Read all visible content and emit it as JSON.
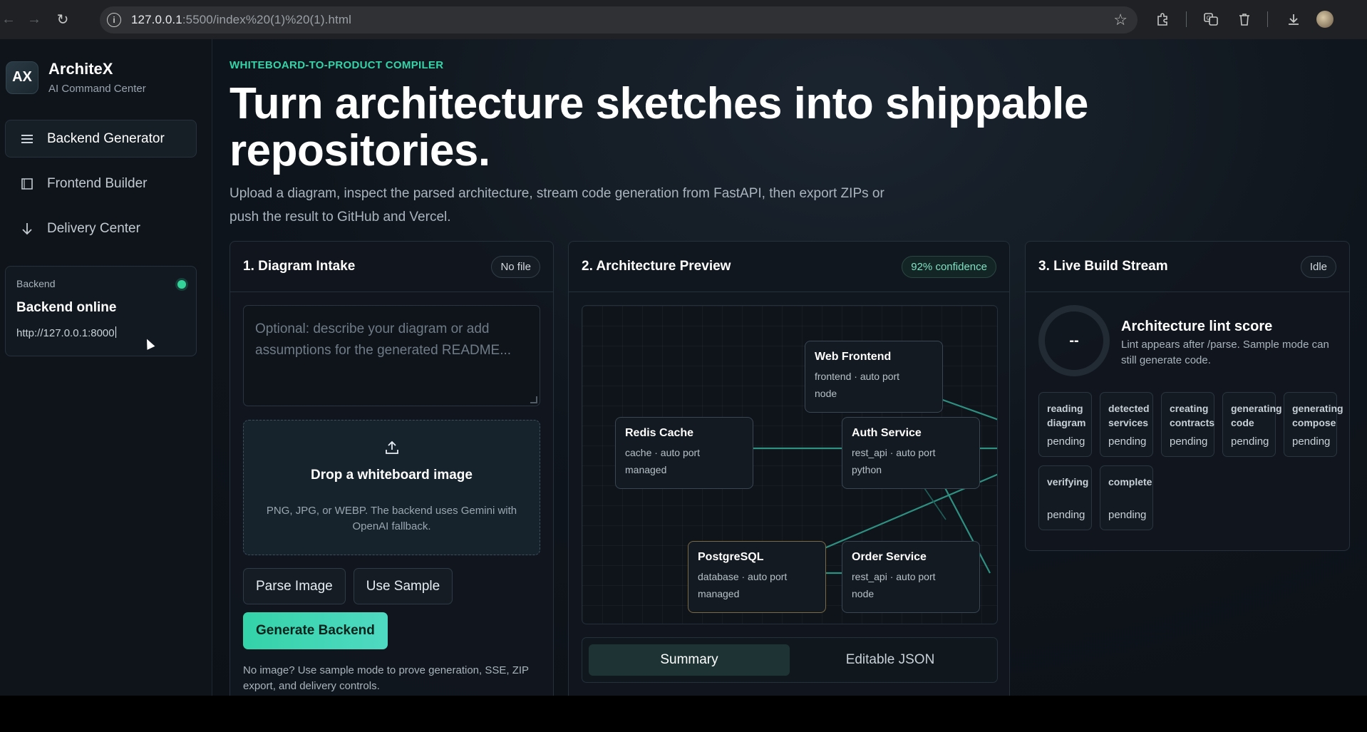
{
  "browser": {
    "url_host": "127.0.0.1",
    "url_path": ":5500/index%20(1)%20(1).html"
  },
  "brand": {
    "logo": "AX",
    "name": "ArchiteX",
    "subtitle": "AI Command Center"
  },
  "sidebar": {
    "items": [
      {
        "label": "Backend Generator",
        "icon": "menu-icon"
      },
      {
        "label": "Frontend Builder",
        "icon": "square-icon"
      },
      {
        "label": "Delivery Center",
        "icon": "arrow-down-icon"
      }
    ],
    "status": {
      "label": "Backend",
      "title": "Backend online",
      "url": "http://127.0.0.1:8000",
      "dot_color": "#34d399"
    }
  },
  "hero": {
    "eyebrow": "WHITEBOARD-TO-PRODUCT COMPILER",
    "title": "Turn architecture sketches into shippable repositories.",
    "lede": "Upload a diagram, inspect the parsed architecture, stream code generation from FastAPI, then export ZIPs or push the result to GitHub and Vercel."
  },
  "intake": {
    "title": "1. Diagram Intake",
    "badge": "No file",
    "placeholder": "Optional: describe your diagram or add assumptions for the generated README...",
    "drop_title": "Drop a whiteboard image",
    "drop_sub": "PNG, JPG, or WEBP. The backend uses Gemini with OpenAI fallback.",
    "parse_label": "Parse Image",
    "sample_label": "Use Sample",
    "generate_label": "Generate Backend",
    "hint": "No image? Use sample mode to prove generation, SSE, ZIP export, and delivery controls."
  },
  "preview": {
    "title": "2. Architecture Preview",
    "badge": "92% confidence",
    "nodes": [
      {
        "title": "Web Frontend",
        "meta": "frontend · auto port",
        "extra": "node"
      },
      {
        "title": "Redis Cache",
        "meta": "cache · auto port",
        "extra": "managed"
      },
      {
        "title": "Auth Service",
        "meta": "rest_api · auto port",
        "extra": "python"
      },
      {
        "title": "PostgreSQL",
        "meta": "database · auto port",
        "extra": "managed"
      },
      {
        "title": "Order Service",
        "meta": "rest_api · auto port",
        "extra": "node"
      }
    ],
    "tabs": [
      "Summary",
      "Editable JSON"
    ],
    "edge_color": "#2f8f80"
  },
  "stream": {
    "title": "3. Live Build Stream",
    "badge": "Idle",
    "score": "--",
    "lint_title": "Architecture lint score",
    "lint_sub": "Lint appears after /parse. Sample mode can still generate code.",
    "stages": [
      {
        "name": "reading diagram",
        "state": "pending"
      },
      {
        "name": "detected services",
        "state": "pending"
      },
      {
        "name": "creating contracts",
        "state": "pending"
      },
      {
        "name": "generating code",
        "state": "pending"
      },
      {
        "name": "generating compose",
        "state": "pending"
      },
      {
        "name": "verifying",
        "state": "pending"
      },
      {
        "name": "complete",
        "state": "pending"
      }
    ]
  },
  "theme": {
    "accent": "#34d3a8",
    "background": "#0f151c"
  }
}
